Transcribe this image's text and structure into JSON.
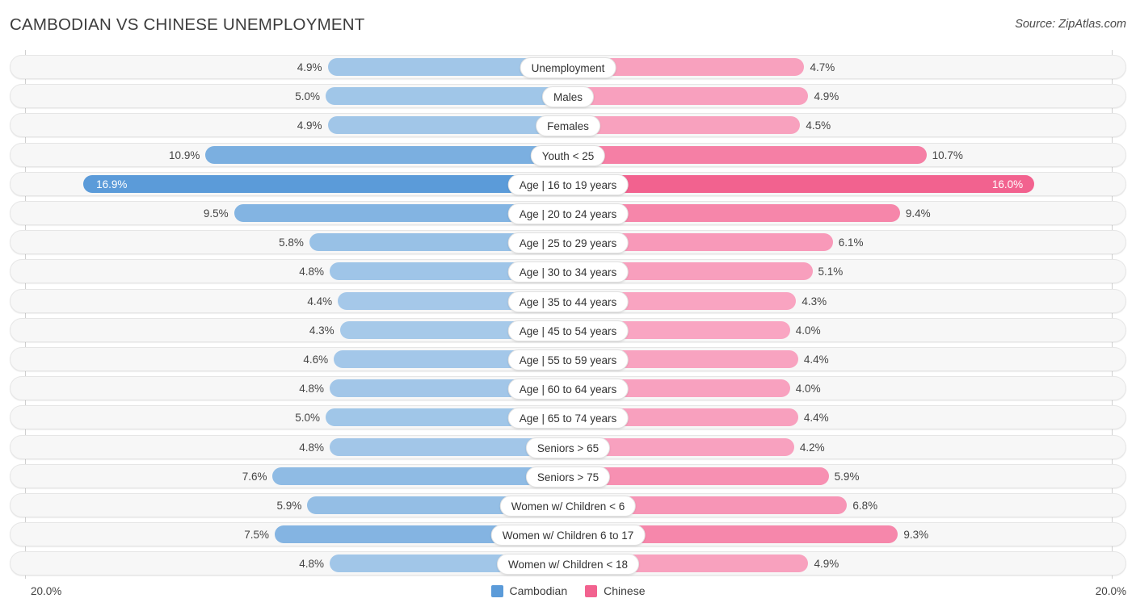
{
  "header": {
    "title": "CAMBODIAN VS CHINESE UNEMPLOYMENT",
    "source": "Source: ZipAtlas.com"
  },
  "footer": {
    "axis_left": "20.0%",
    "axis_right": "20.0%",
    "legend": [
      {
        "label": "Cambodian",
        "color": "#5B9BD9"
      },
      {
        "label": "Chinese",
        "color": "#F2628F"
      }
    ]
  },
  "chart_data": {
    "type": "bar",
    "title": "CAMBODIAN VS CHINESE UNEMPLOYMENT",
    "subtitle": "Source: ZipAtlas.com",
    "orientation": "horizontal-diverging",
    "xlabel": "",
    "ylabel": "",
    "xlim": [
      0,
      20
    ],
    "axis_max_label": "20.0%",
    "grid": false,
    "legend_position": "bottom-center",
    "categories": [
      "Unemployment",
      "Males",
      "Females",
      "Youth < 25",
      "Age | 16 to 19 years",
      "Age | 20 to 24 years",
      "Age | 25 to 29 years",
      "Age | 30 to 34 years",
      "Age | 35 to 44 years",
      "Age | 45 to 54 years",
      "Age | 55 to 59 years",
      "Age | 60 to 64 years",
      "Age | 65 to 74 years",
      "Seniors > 65",
      "Seniors > 75",
      "Women w/ Children < 6",
      "Women w/ Children 6 to 17",
      "Women w/ Children < 18"
    ],
    "series": [
      {
        "name": "Cambodian",
        "color": "#5B9BD9",
        "values": [
          4.9,
          5.0,
          4.9,
          10.9,
          16.9,
          9.5,
          5.8,
          4.8,
          4.4,
          4.3,
          4.6,
          4.8,
          5.0,
          4.8,
          7.6,
          5.9,
          7.5,
          4.8
        ],
        "labels": [
          "4.9%",
          "5.0%",
          "4.9%",
          "10.9%",
          "16.9%",
          "9.5%",
          "5.8%",
          "4.8%",
          "4.4%",
          "4.3%",
          "4.6%",
          "4.8%",
          "5.0%",
          "4.8%",
          "7.6%",
          "5.9%",
          "7.5%",
          "4.8%"
        ]
      },
      {
        "name": "Chinese",
        "color": "#F2628F",
        "values": [
          4.7,
          4.9,
          4.5,
          10.7,
          16.0,
          9.4,
          6.1,
          5.1,
          4.3,
          4.0,
          4.4,
          4.0,
          4.4,
          4.2,
          5.9,
          6.8,
          9.3,
          4.9
        ],
        "labels": [
          "4.7%",
          "4.9%",
          "4.5%",
          "10.7%",
          "16.0%",
          "9.4%",
          "6.1%",
          "5.1%",
          "4.3%",
          "4.0%",
          "4.4%",
          "4.0%",
          "4.4%",
          "4.2%",
          "5.9%",
          "6.8%",
          "9.3%",
          "4.9%"
        ]
      }
    ],
    "highlighted_category": "Age | 16 to 19 years"
  }
}
